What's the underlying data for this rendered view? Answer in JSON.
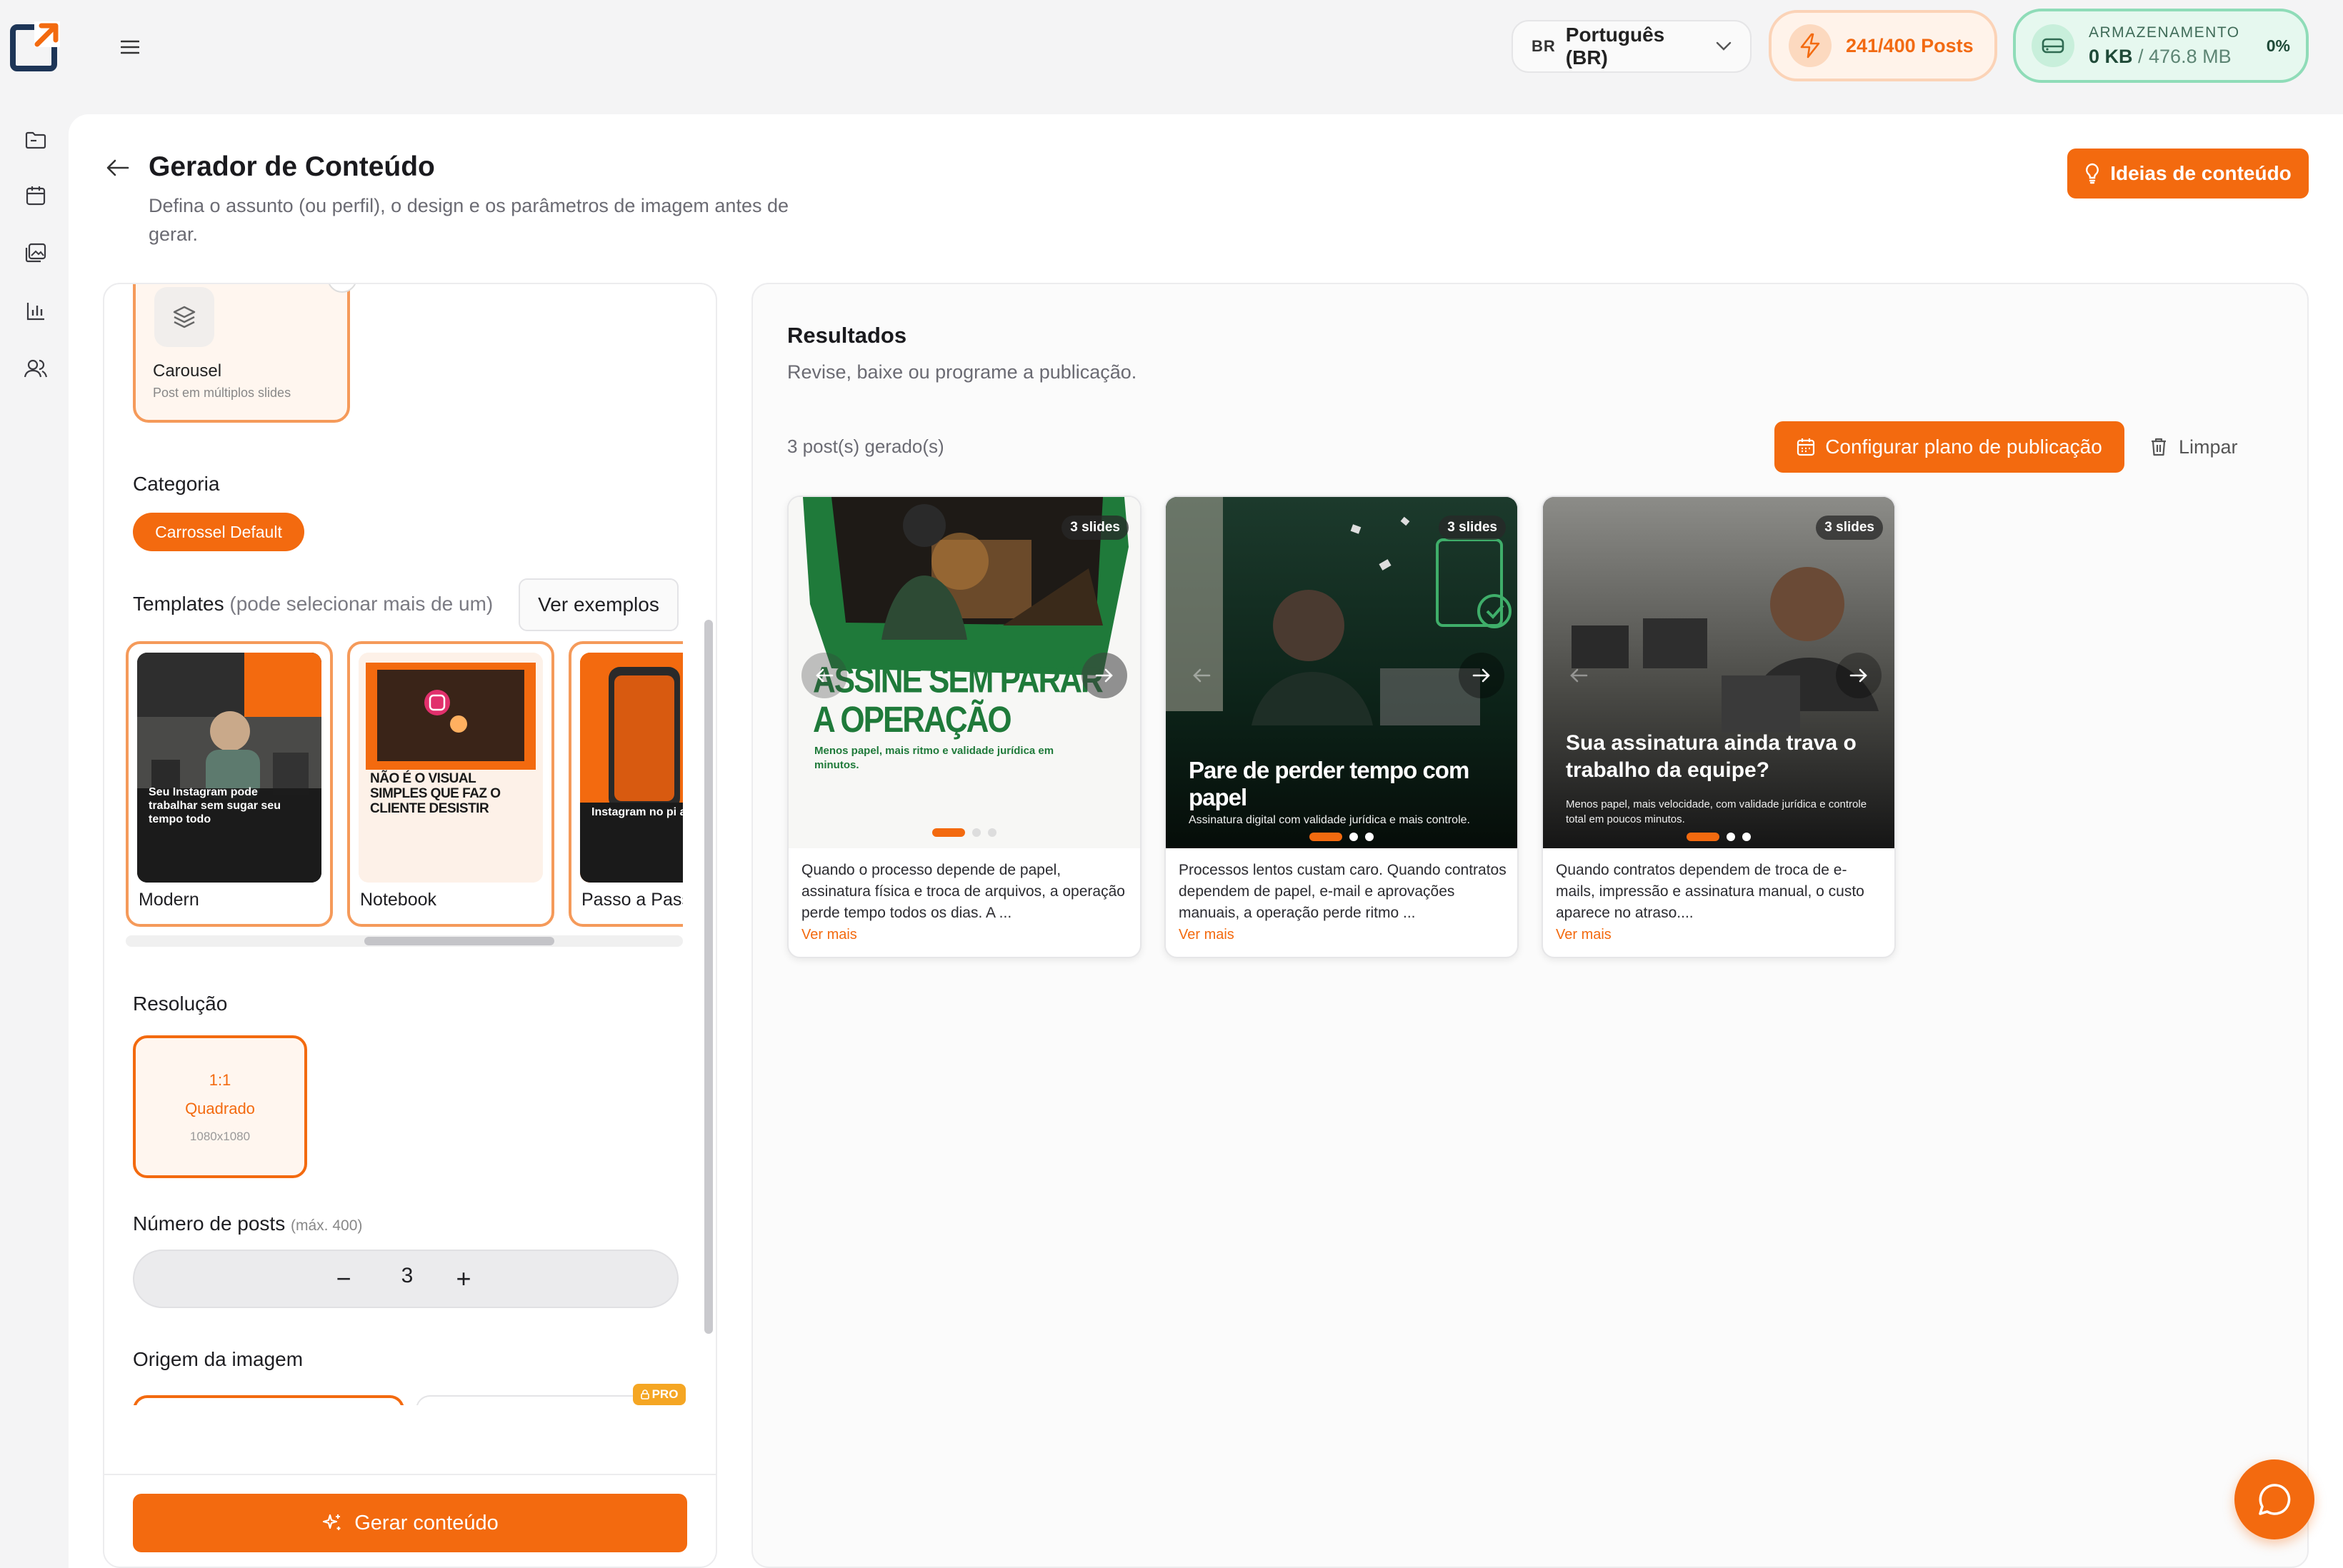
{
  "topbar": {
    "language_code": "BR",
    "language_name": "Português (BR)",
    "posts_counter": "241/400 Posts",
    "storage_label": "ARMAZENAMENTO",
    "storage_used": "0 KB",
    "storage_total": " / 476.8 MB",
    "storage_percent": "0%",
    "colors": {
      "accent": "#f36a0f",
      "storage": "#8fdcb8"
    }
  },
  "sidebar": {
    "icons": [
      "folder-icon",
      "calendar-icon",
      "gallery-icon",
      "chart-icon",
      "users-icon"
    ]
  },
  "header": {
    "title": "Gerador de Conteúdo",
    "subtitle": "Defina o assunto (ou perfil), o design e os parâmetros de imagem antes de gerar.",
    "ideas_button": "Ideias de conteúdo"
  },
  "config": {
    "format_card": {
      "title": "Carousel",
      "subtitle": "Post em múltiplos slides"
    },
    "category_label": "Categoria",
    "category_chip": "Carrossel Default",
    "templates_label": "Templates",
    "templates_hint": "(pode selecionar mais de um)",
    "examples_button": "Ver exemplos",
    "templates": [
      {
        "label": "Modern",
        "headline": "Seu Instagram pode trabalhar sem sugar seu tempo todo"
      },
      {
        "label": "Notebook",
        "headline": "NÃO É O VISUAL SIMPLES QUE FAZ O CLIENTE DESISTIR"
      },
      {
        "label": "Passo a Pass",
        "headline": "Instagram no pi automático"
      }
    ],
    "resolution_label": "Resolução",
    "resolution": {
      "ratio": "1:1",
      "name": "Quadrado",
      "size": "1080x1080"
    },
    "posts_label": "Número de posts",
    "posts_max": "(máx. 400)",
    "posts_value": "3",
    "minus": "−",
    "plus": "+",
    "image_origin_label": "Origem da imagem",
    "pro_badge": "PRO",
    "generate_button": "Gerar conteúdo"
  },
  "results": {
    "title": "Resultados",
    "subtitle": "Revise, baixe ou programe a publicação.",
    "count": "3 post(s) gerado(s)",
    "plan_button": "Configurar plano de publicação",
    "clear_button": "Limpar",
    "posts": [
      {
        "slides": "3 slides",
        "headline": "ASSINE SEM PARAR A OPERAÇÃO",
        "subline": "Menos papel, mais ritmo e validade jurídica em minutos.",
        "caption": "Quando o processo depende de papel, assinatura física e troca de arquivos, a operação perde tempo todos os dias. A ...",
        "more": "Ver mais"
      },
      {
        "slides": "3 slides",
        "headline": "Pare de perder tempo com papel",
        "subline": "Assinatura digital com validade jurídica e mais controle.",
        "caption": "Processos lentos custam caro. Quando contratos dependem de papel, e-mail e aprovações manuais, a operação perde ritmo ...",
        "more": "Ver mais"
      },
      {
        "slides": "3 slides",
        "headline": "Sua assinatura ainda trava o trabalho da equipe?",
        "subline": "Menos papel, mais velocidade, com validade jurídica e controle total em poucos minutos.",
        "caption": "Quando contratos dependem de troca de e-mails, impressão e assinatura manual, o custo aparece no atraso....",
        "more": "Ver mais"
      }
    ]
  }
}
